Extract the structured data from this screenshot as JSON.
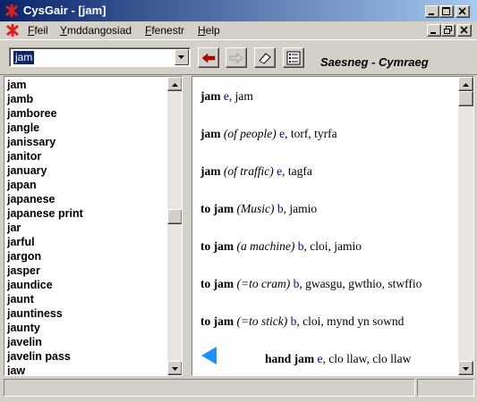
{
  "window": {
    "title": "CysGair - [jam]"
  },
  "menubar": {
    "items": [
      {
        "label": "Ffeil"
      },
      {
        "label": "Ymddangosiad"
      },
      {
        "label": "Ffenestr"
      },
      {
        "label": "Help"
      }
    ]
  },
  "toolbar": {
    "search_value": "jam",
    "direction_label": "Saesneg - Cymraeg",
    "buttons": [
      "back-arrow-icon",
      "forward-arrow-icon",
      "eraser-icon",
      "list-icon"
    ]
  },
  "wordlist": {
    "items": [
      "jam",
      "jamb",
      "jamboree",
      "jangle",
      "janissary",
      "janitor",
      "january",
      "japan",
      "japanese",
      "japanese print",
      "jar",
      "jarful",
      "jargon",
      "jasper",
      "jaundice",
      "jaunt",
      "jauntiness",
      "jaunty",
      "javelin",
      "javelin pass",
      "jaw"
    ]
  },
  "entries": [
    {
      "head": "jam",
      "qualifier": "",
      "pos": "e",
      "translation": ", jam"
    },
    {
      "head": "jam",
      "qualifier": " (of people)",
      "pos": "e",
      "translation": ", torf, tyrfa"
    },
    {
      "head": "jam",
      "qualifier": " (of traffic)",
      "pos": "e",
      "translation": ", tagfa"
    },
    {
      "prefix": "to ",
      "head": "jam",
      "qualifier": " (Music)",
      "pos": "b",
      "translation": ", jamio"
    },
    {
      "prefix": "to ",
      "head": "jam",
      "qualifier": " (a machine)",
      "pos": "b",
      "translation": ", cloi, jamio"
    },
    {
      "prefix": "to ",
      "head": "jam",
      "qualifier": " (=to cram)",
      "pos": "b",
      "translation": ", gwasgu, gwthio, stwffio"
    },
    {
      "prefix": "to ",
      "head": "jam",
      "qualifier": " (=to stick)",
      "pos": "b",
      "translation": ", cloi, mynd yn sownd"
    },
    {
      "prefix": "hand ",
      "head": "jam",
      "qualifier": "",
      "pos": "e",
      "translation": ", clo llaw, clo llaw"
    }
  ],
  "colors": {
    "title_gradient_start": "#0a246a",
    "title_gradient_end": "#a6caf0",
    "pos_color": "#00008b",
    "selection": "#0a246a",
    "nav_arrow": "#1e90ff"
  }
}
